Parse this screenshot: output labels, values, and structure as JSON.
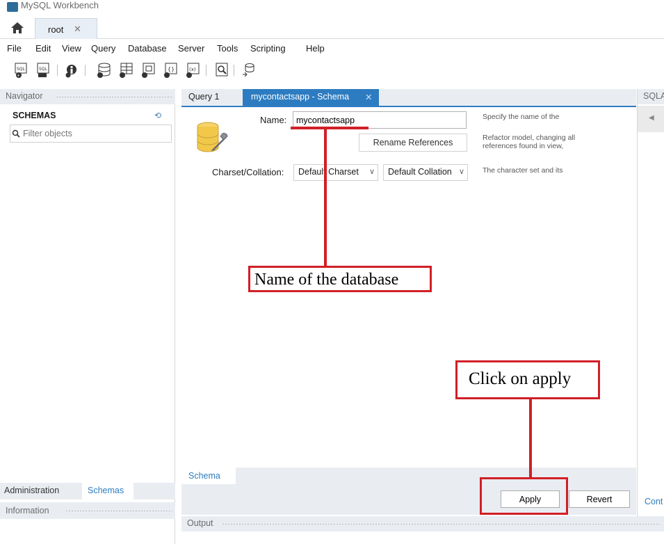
{
  "window": {
    "title": "MySQL Workbench"
  },
  "connection_tab": {
    "label": "root",
    "close": "✕"
  },
  "menu": [
    "File",
    "Edit",
    "View",
    "Query",
    "Database",
    "Server",
    "Tools",
    "Scripting",
    "Help"
  ],
  "navigator": {
    "header": "Navigator",
    "schemas_label": "SCHEMAS",
    "filter_placeholder": "Filter objects",
    "bottom_tabs": [
      "Administration",
      "Schemas"
    ],
    "information_header": "Information"
  },
  "editor": {
    "tabs": [
      "Query 1",
      "mycontactsapp - Schema"
    ],
    "name_label": "Name:",
    "name_value": "mycontactsapp",
    "rename_button": "Rename References",
    "charset_label": "Charset/Collation:",
    "charset_value": "Default Charset",
    "collation_value": "Default Collation",
    "help_name": "Specify the name of the",
    "help_rename": [
      "Refactor model, changing all",
      "references found in view,"
    ],
    "help_charset": "The character set and its",
    "subtab": "Schema",
    "apply_button": "Apply",
    "revert_button": "Revert"
  },
  "output": {
    "header": "Output"
  },
  "right_panel": {
    "header": "SQLA",
    "link": "Cont"
  },
  "annotations": {
    "name_callout": "Name of the database",
    "apply_callout": "Click on apply"
  },
  "colors": {
    "accent": "#2d7cc1",
    "annotation": "#d11f26",
    "panel_bg": "#e9edf2"
  }
}
